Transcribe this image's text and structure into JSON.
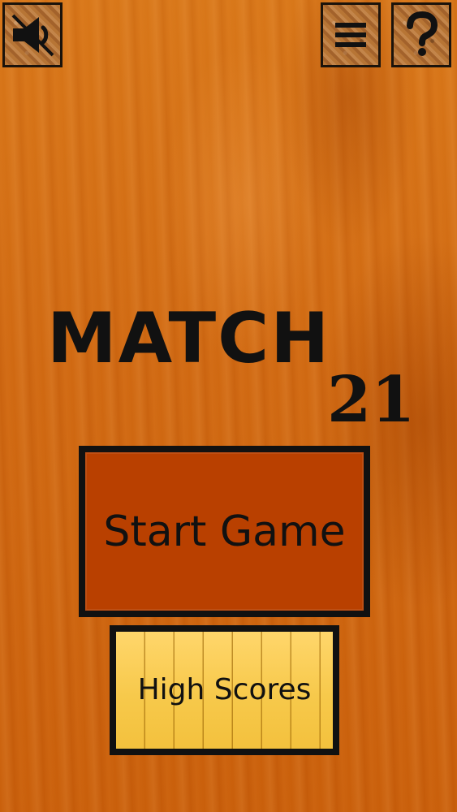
{
  "header": {
    "sound_icon": "speaker-muted-icon",
    "menu_icon": "menu-icon",
    "help_icon": "question-mark-icon"
  },
  "title": {
    "main": "MATCH",
    "number": "21"
  },
  "buttons": {
    "start_game": "Start Game",
    "high_scores": "High Scores"
  },
  "colors": {
    "background": "#d06912",
    "start_button": "#b94000",
    "high_scores_button": "#f7c94b",
    "outline": "#111111"
  }
}
